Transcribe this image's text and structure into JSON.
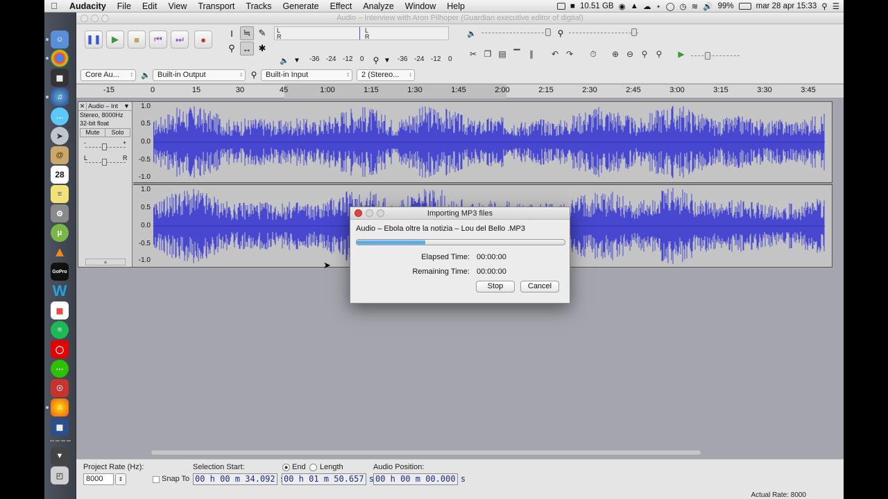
{
  "menubar": {
    "app": "Audacity",
    "items": [
      "File",
      "Edit",
      "View",
      "Transport",
      "Tracks",
      "Generate",
      "Effect",
      "Analyze",
      "Window",
      "Help"
    ],
    "disk": "10.51 GB",
    "battery": "99%",
    "datetime": "mar 28 apr  15:33"
  },
  "window": {
    "title": "Audio – Interview with Aron Pilhoper (Guardian executive editor of digital)"
  },
  "meters": {
    "play_ticks": [
      "-36",
      "-24",
      "-12",
      "0"
    ],
    "rec_ticks": [
      "-36",
      "-24",
      "-12",
      "0"
    ],
    "l": "L",
    "r": "R"
  },
  "devices": {
    "host": "Core Au...",
    "output": "Built-in Output",
    "input": "Built-in Input",
    "channels": "2 (Stereo..."
  },
  "ruler": {
    "ticks": [
      "-15",
      "0",
      "15",
      "30",
      "45",
      "1:00",
      "1:15",
      "1:30",
      "1:45",
      "2:00",
      "2:15",
      "2:30",
      "2:45",
      "3:00",
      "3:15",
      "3:30",
      "3:45"
    ]
  },
  "track": {
    "name": "Audio – Int",
    "format": "Stereo, 8000Hz",
    "bits": "32-bit float",
    "mute": "Mute",
    "solo": "Solo",
    "gain_minus": "-",
    "gain_plus": "+",
    "pan_l": "L",
    "pan_r": "R",
    "scale": [
      "1.0",
      "0.5",
      "0.0",
      "-0.5",
      "-1.0"
    ],
    "wave_color": "#4747cf"
  },
  "dialog": {
    "title": "Importing MP3 files",
    "file": "Audio – Ebola oltre la notizia – Lou del Bello .MP3",
    "progress": 0.33,
    "elapsed_label": "Elapsed Time:",
    "elapsed_value": "00:00:00",
    "remaining_label": "Remaining Time:",
    "remaining_value": "00:00:00",
    "stop": "Stop",
    "cancel": "Cancel"
  },
  "bottom": {
    "project_rate_label": "Project Rate (Hz):",
    "project_rate": "8000",
    "snap_to": "Snap To",
    "selection_start_label": "Selection Start:",
    "end_label": "End",
    "length_label": "Length",
    "audio_position_label": "Audio Position:",
    "start": "00 h 00 m 34.092 s",
    "end": "00 h 01 m 50.657 s",
    "position": "00 h 00 m 00.000 s",
    "actual_rate": "Actual Rate: 8000"
  }
}
